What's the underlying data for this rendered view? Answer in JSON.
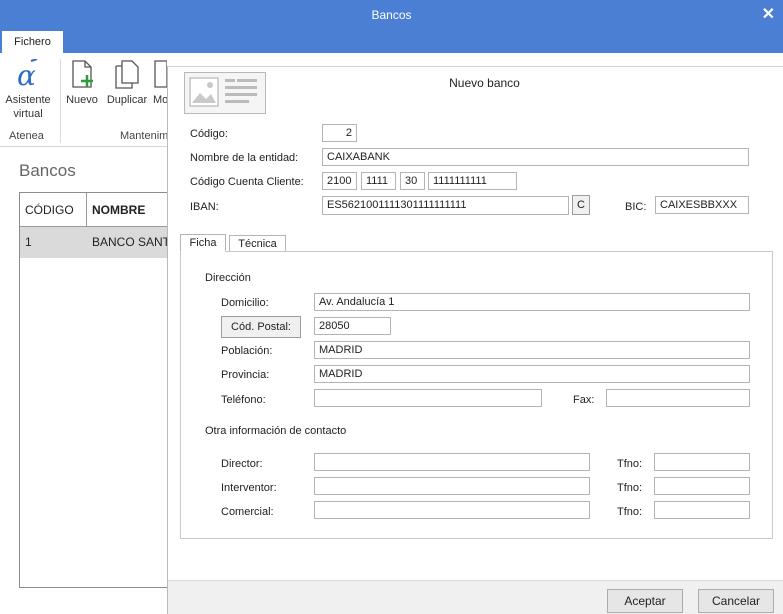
{
  "window": {
    "title": "Bancos",
    "close_label": "✕"
  },
  "ribbon": {
    "tab": "Fichero",
    "buttons": {
      "asistente_line1": "Asistente",
      "asistente_line2": "virtual",
      "nuevo": "Nuevo",
      "duplicar": "Duplicar",
      "mo": "Mo"
    },
    "groups": {
      "atenea": "Atenea",
      "mantenim": "Mantenim"
    }
  },
  "page": {
    "title": "Bancos"
  },
  "grid": {
    "columns": [
      "CÓDIGO",
      "NOMBRE"
    ],
    "rows": [
      {
        "codigo": "1",
        "nombre": "BANCO SANTA"
      }
    ]
  },
  "dialog": {
    "title": "Nuevo banco",
    "codigo": {
      "label": "Código:",
      "value": "2"
    },
    "entidad": {
      "label": "Nombre de la entidad:",
      "value": "CAIXABANK"
    },
    "ccc": {
      "label": "Código Cuenta Cliente:",
      "entidad": "2100",
      "oficina": "1111",
      "dc": "30",
      "cuenta": "1111111111"
    },
    "iban": {
      "label": "IBAN:",
      "value": "ES5621001111301111111111",
      "button": "C"
    },
    "bic": {
      "label": "BIC:",
      "value": "CAIXESBBXXX"
    },
    "tabs": [
      "Ficha",
      "Técnica"
    ],
    "direccion": {
      "heading": "Dirección",
      "domicilio": {
        "label": "Domicilio:",
        "value": "Av. Andalucía 1"
      },
      "cp": {
        "button": "Cód. Postal:",
        "value": "28050"
      },
      "poblacion": {
        "label": "Población:",
        "value": "MADRID"
      },
      "provincia": {
        "label": "Provincia:",
        "value": "MADRID"
      },
      "telefono": {
        "label": "Teléfono:",
        "value": ""
      },
      "fax": {
        "label": "Fax:",
        "value": ""
      }
    },
    "contacto": {
      "heading": "Otra información de contacto",
      "director": {
        "label": "Director:",
        "value": ""
      },
      "interventor": {
        "label": "Interventor:",
        "value": ""
      },
      "comercial": {
        "label": "Comercial:",
        "value": ""
      },
      "tfno_label": "Tfno:"
    },
    "footer": {
      "aceptar": "Aceptar",
      "cancelar": "Cancelar"
    }
  },
  "colors": {
    "titlebar": "#4a7fd4",
    "accent_green": "#2e9e3a",
    "alpha_blue": "#2f6cc4"
  }
}
